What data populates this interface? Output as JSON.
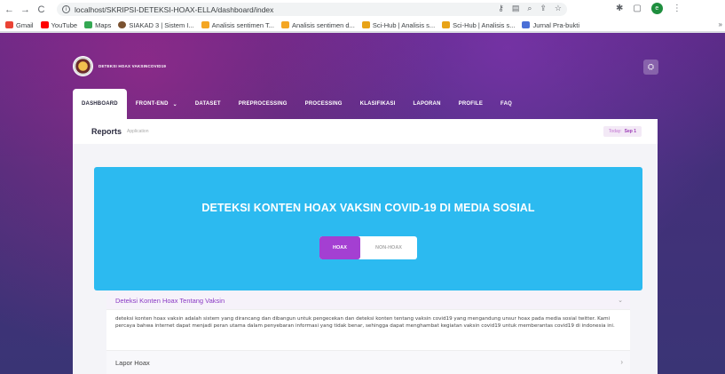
{
  "browser": {
    "url": "localhost/SKRIPSI-DETEKSI-HOAX-ELLA/dashboard/index",
    "bookmarks": [
      {
        "label": "Gmail",
        "color": "#ea4335"
      },
      {
        "label": "YouTube",
        "color": "#ff0000"
      },
      {
        "label": "Maps",
        "color": "#34a853"
      },
      {
        "label": "SIAKAD 3 | Sistem I...",
        "color": "#7a5230"
      },
      {
        "label": "Analisis sentimen T...",
        "color": "#f4a623"
      },
      {
        "label": "Analisis sentimen d...",
        "color": "#f4a623"
      },
      {
        "label": "Sci-Hub | Analisis s...",
        "color": "#e8a317"
      },
      {
        "label": "Sci-Hub | Analisis s...",
        "color": "#e8a317"
      },
      {
        "label": "Jurnal Pra-bukti",
        "color": "#4a6fd6"
      }
    ],
    "more": "»",
    "profile_initial": "e"
  },
  "header": {
    "brand": "DETEKSI HOAX VAKSINCOVID19"
  },
  "menu": [
    {
      "label": "DASHBOARD",
      "active": true
    },
    {
      "label": "FRONT-END",
      "dropdown": true
    },
    {
      "label": "DATASET"
    },
    {
      "label": "PREPROCESSING"
    },
    {
      "label": "PROCESSING"
    },
    {
      "label": "KLASIFIKASI"
    },
    {
      "label": "LAPORAN"
    },
    {
      "label": "PROFILE"
    },
    {
      "label": "FAQ"
    }
  ],
  "reports": {
    "title": "Reports",
    "subtitle": "Application",
    "today_label": "Today:",
    "today_value": "Sep 1"
  },
  "hero": {
    "title": "DETEKSI KONTEN HOAX VAKSIN COVID-19 DI MEDIA SOSIAL",
    "tabs": [
      "HOAX",
      "NON-HOAX"
    ]
  },
  "accordion": {
    "item1_title": "Deteksi Konten Hoax Tentang Vaksin",
    "item1_body": "deteksi konten hoax vaksin adalah sistem yang dirancang dan dibangun untuk pengecekan dan deteksi konten tentang vaksin covid19 yang mengandung unsur hoax pada media sosial twitter. Kami percaya bahwa internet dapat menjadi peran utama dalam penyebaran informasi yang tidak benar, sehingga dapat menghambat kegiatan vaksin covid19 untuk memberantas covid19 di indonesia ini.",
    "item2_title": "Lapor Hoax"
  },
  "colors": {
    "accent": "#a43fd2",
    "hero": "#2cbaf0",
    "page_bg": "#43307a"
  }
}
